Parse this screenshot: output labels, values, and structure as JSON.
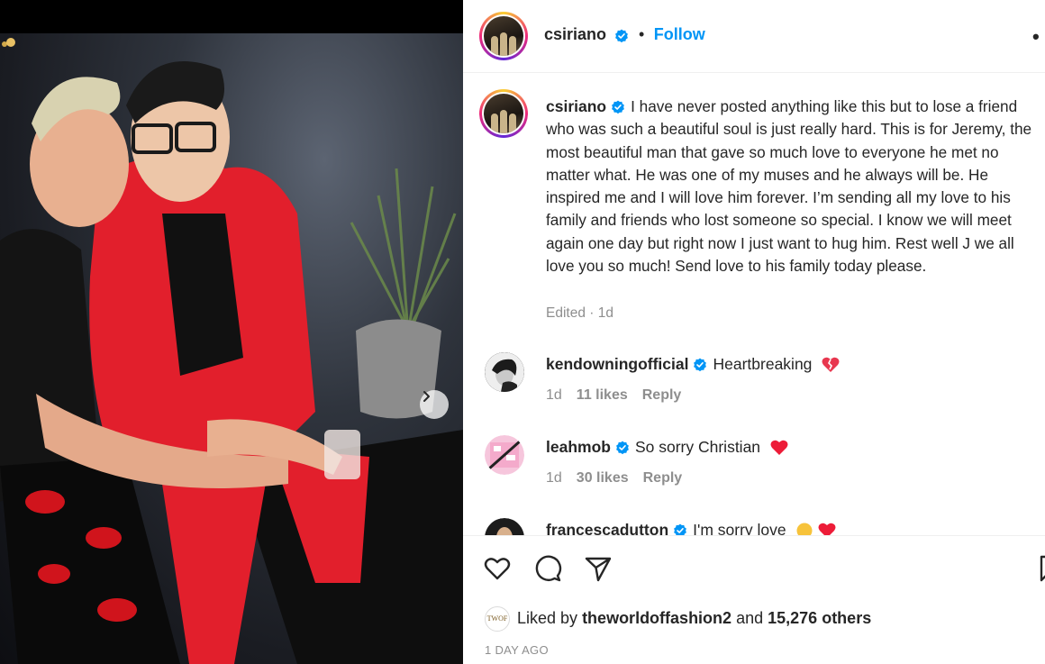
{
  "post": {
    "author": "csiriano",
    "follow_label": "Follow",
    "separator": "•",
    "more_label": "•",
    "caption": "I have never posted anything like this but to lose a friend who was such a beautiful soul is just really hard. This is for Jeremy, the most beautiful man that gave so much love to everyone he met no matter what. He was one of my muses and he always will be. He inspired me and I will love him forever. I’m sending all my love to his family and friends who lost someone so special. I know we will meet again one day but right now I just want to hug him. Rest well J we all love you so much! Send love to his family today please.",
    "edited": "Edited · 1d"
  },
  "comments": [
    {
      "user": "kendowningofficial",
      "text": "Heartbreaking",
      "emoji": "broken-heart",
      "age": "1d",
      "likes": "11 likes",
      "reply": "Reply"
    },
    {
      "user": "leahmob",
      "text": "So sorry Christian",
      "emoji": "red-heart",
      "age": "1d",
      "likes": "30 likes",
      "reply": "Reply"
    },
    {
      "user": "francescadutton",
      "text": "I'm sorry love",
      "emoji": "crying-face red-heart"
    }
  ],
  "footer": {
    "liked_prefix": "Liked by",
    "liked_user": "theworldoffashion2",
    "liked_and": "and",
    "liked_count": "15,276 others",
    "date": "1 DAY AGO",
    "liker_avatar_text": "TWOF"
  },
  "colors": {
    "accent": "#0095f6",
    "verified": "#0095f6",
    "heart": "#ed4956",
    "muted": "#8e8e8e"
  },
  "icons": [
    "heart-icon",
    "comment-icon",
    "share-icon",
    "bookmark-icon",
    "verified-icon",
    "next-arrow-icon"
  ]
}
